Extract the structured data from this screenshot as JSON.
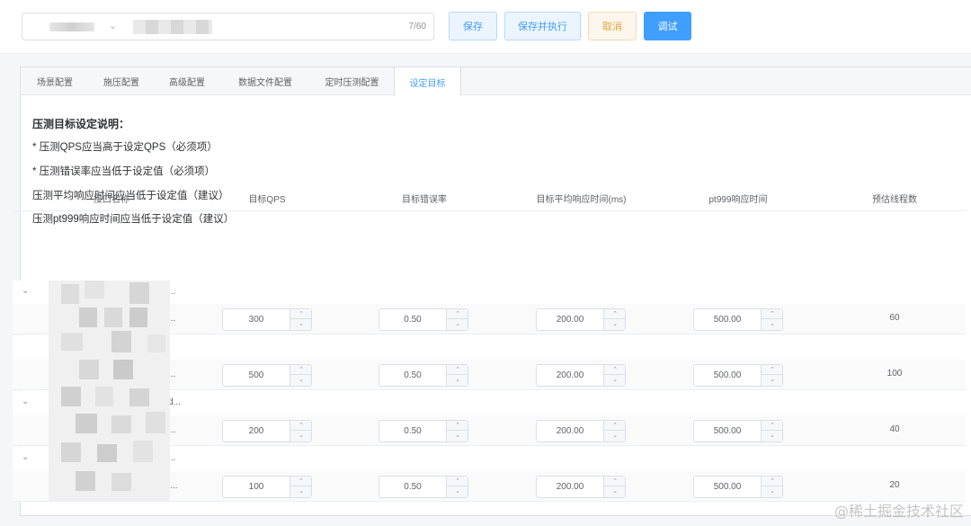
{
  "header": {
    "name_count": "7/60",
    "buttons": {
      "save": "保存",
      "save_run": "保存并执行",
      "cancel": "取消",
      "debug": "调试"
    }
  },
  "tabs": [
    "场景配置",
    "施压配置",
    "高级配置",
    "数据文件配置",
    "定时压测配置",
    "设定目标"
  ],
  "active_tab": "设定目标",
  "description": {
    "title": "压测目标设定说明：",
    "lines": [
      "* 压测QPS应当高于设定QPS（必须项）",
      "* 压测错误率应当低于设定值（必须项）",
      "压测平均响应时间应当低于设定值（建议）",
      "压测pt999响应时间应当低于设定值（建议）"
    ]
  },
  "table": {
    "headers": [
      "接口名称",
      "目标QPS",
      "目标错误率",
      "目标平均响应时间(ms)",
      "pt999响应时间",
      "预估线程数"
    ],
    "rows": [
      {
        "qps": "300",
        "error_rate": "0.50",
        "avg_rt": "200.00",
        "pt999": "500.00",
        "threads": "60"
      },
      {
        "qps": "500",
        "error_rate": "0.50",
        "avg_rt": "200.00",
        "pt999": "500.00",
        "threads": "100"
      },
      {
        "qps": "200",
        "error_rate": "0.50",
        "avg_rt": "200.00",
        "pt999": "500.00",
        "threads": "40"
      },
      {
        "qps": "100",
        "error_rate": "0.50",
        "avg_rt": "200.00",
        "pt999": "500.00",
        "threads": "20"
      }
    ]
  },
  "watermark": "@稀土掘金技术社区",
  "colors": {
    "primary": "#409eff",
    "warning": "#e6a23c"
  }
}
